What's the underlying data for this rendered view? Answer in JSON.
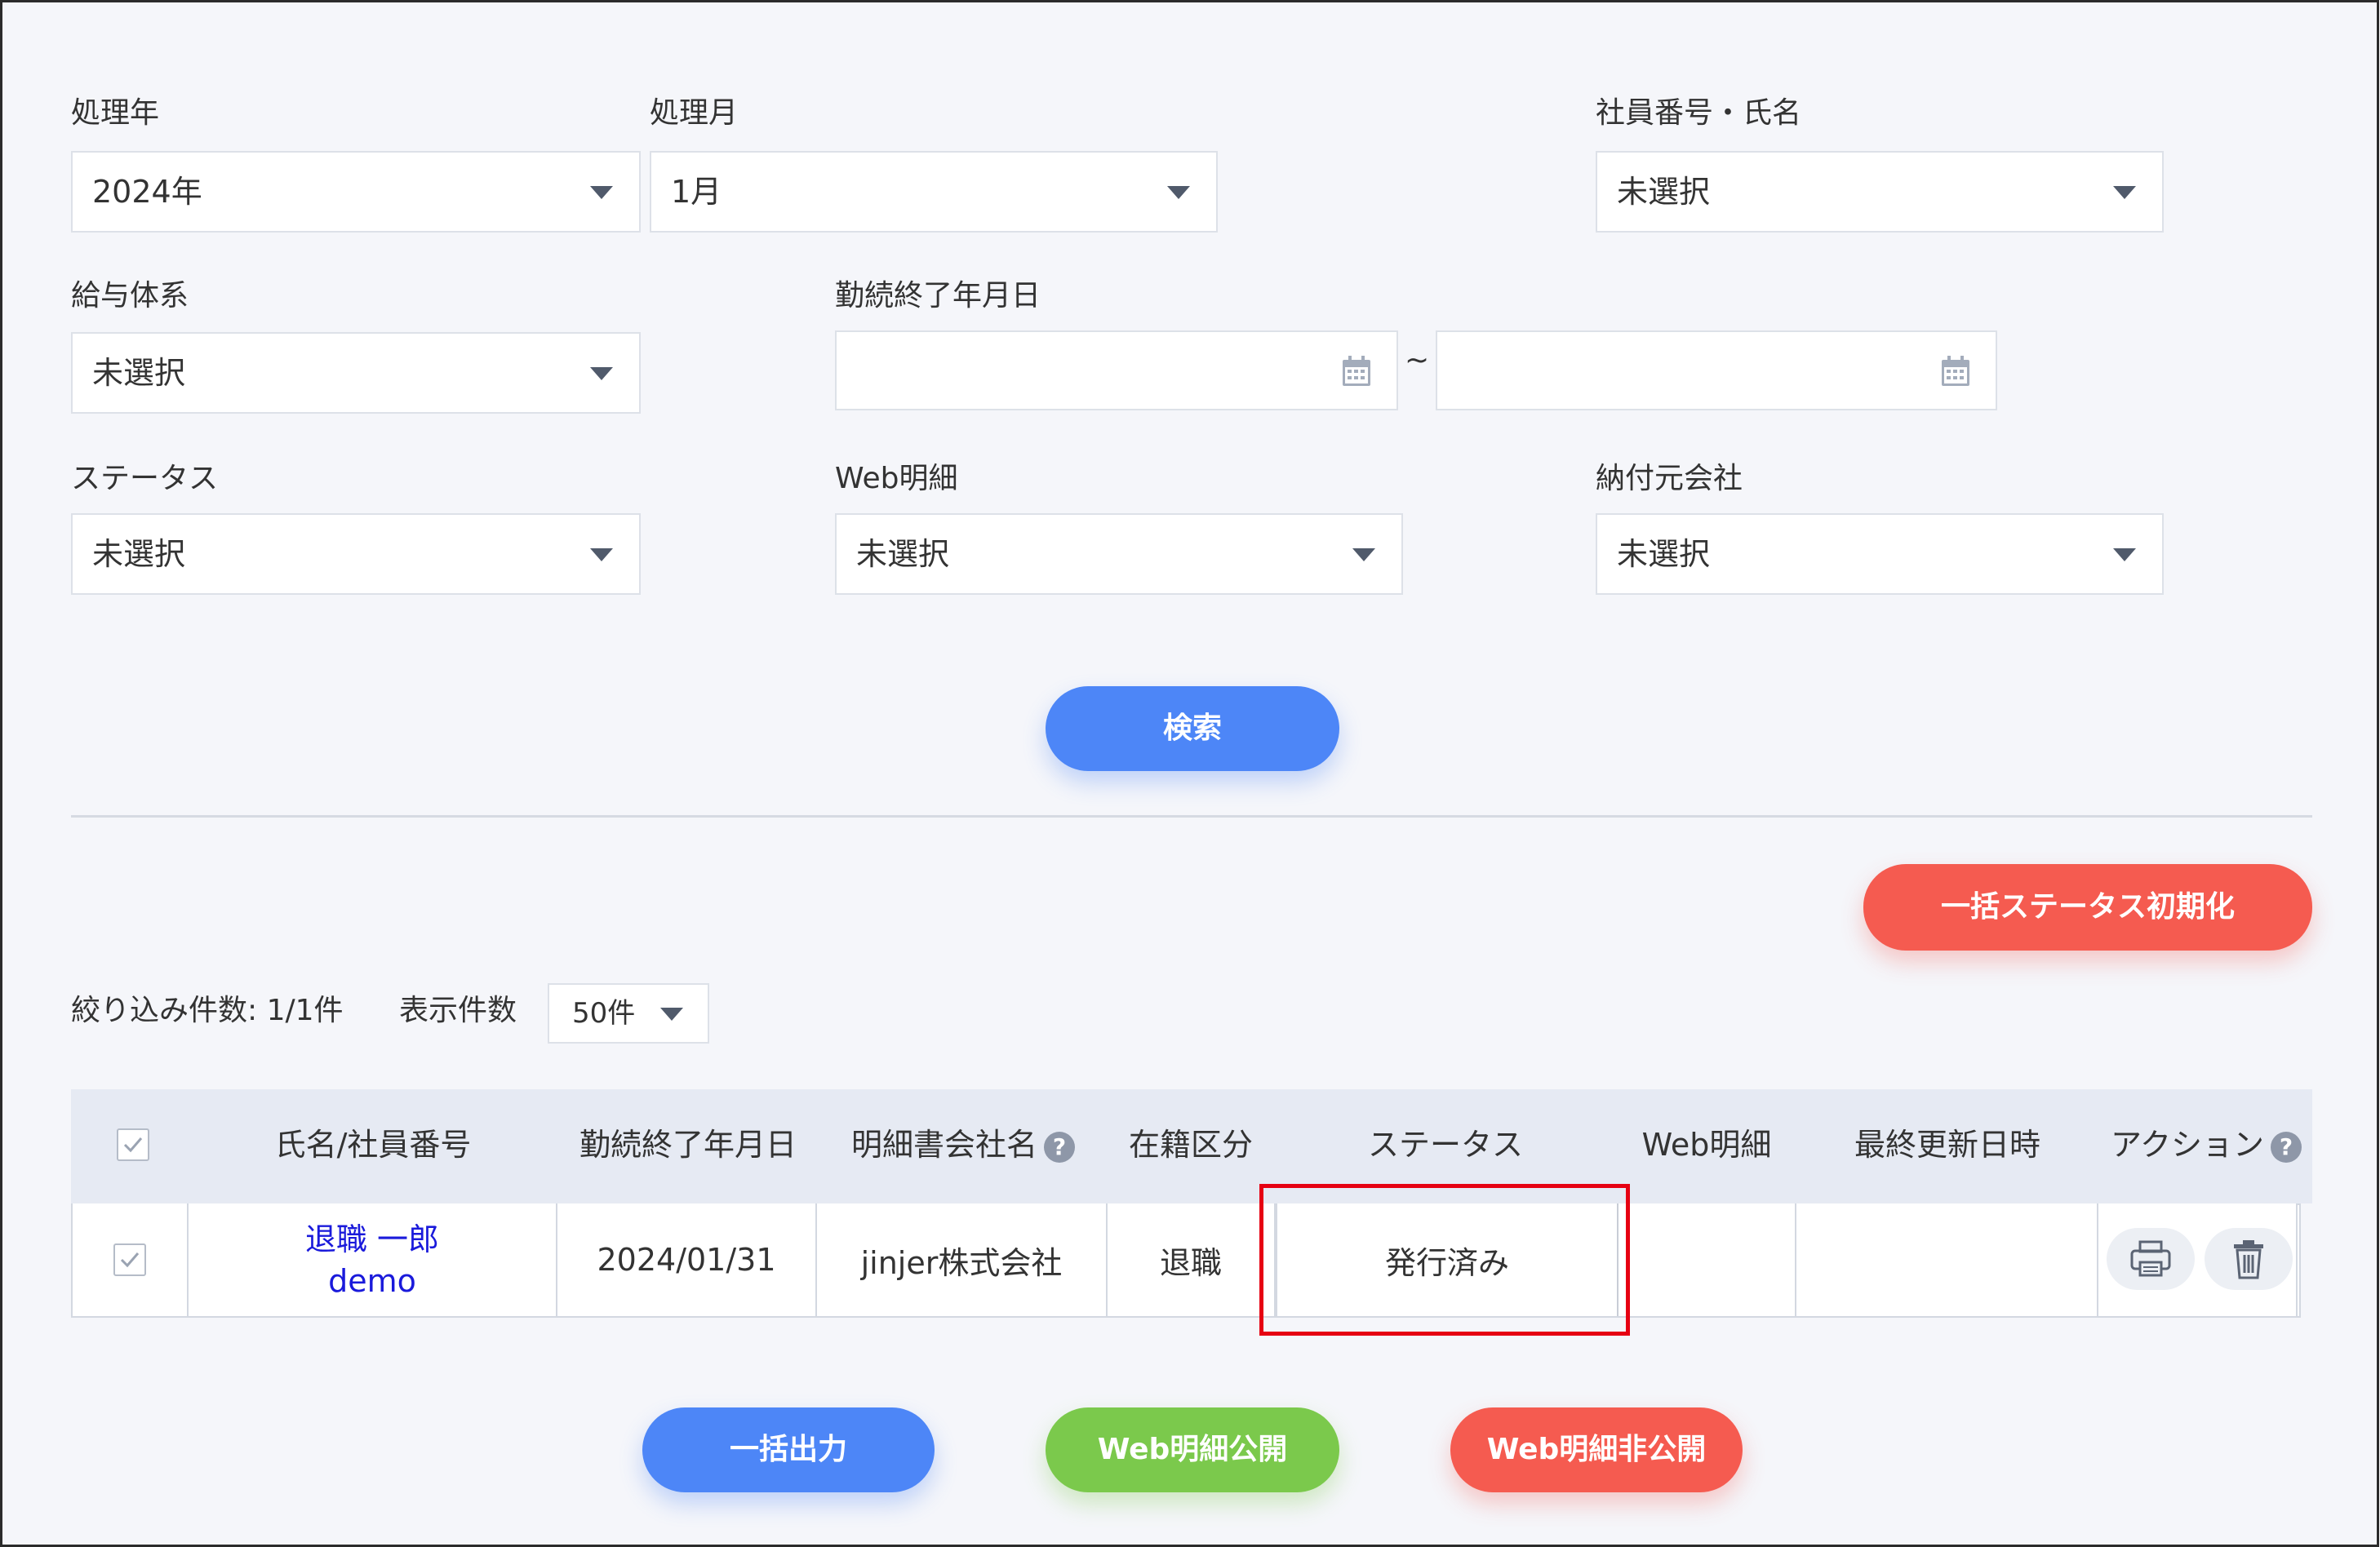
{
  "filters": {
    "year": {
      "label": "処理年",
      "value": "2024年"
    },
    "month": {
      "label": "処理月",
      "value": "1月"
    },
    "employee": {
      "label": "社員番号・氏名",
      "value": "未選択"
    },
    "salary_system": {
      "label": "給与体系",
      "value": "未選択"
    },
    "end_date": {
      "label": "勤続終了年月日",
      "from": "",
      "to": "",
      "separator": "~"
    },
    "status": {
      "label": "ステータス",
      "value": "未選択"
    },
    "web_statement": {
      "label": "Web明細",
      "value": "未選択"
    },
    "payment_company": {
      "label": "納付元会社",
      "value": "未選択"
    }
  },
  "search_label": "検索",
  "bulk_reset_label": "一括ステータス初期化",
  "count": {
    "filtered_label": "絞り込み件数: 1/1件",
    "per_page_label": "表示件数",
    "per_page_value": "50件"
  },
  "table": {
    "headers": {
      "name": "氏名/社員番号",
      "end_date": "勤続終了年月日",
      "company": "明細書会社名",
      "enrollment": "在籍区分",
      "status": "ステータス",
      "web": "Web明細",
      "updated": "最終更新日時",
      "action": "アクション"
    },
    "rows": [
      {
        "name": "退職 一郎",
        "employee_no": "demo",
        "end_date": "2024/01/31",
        "company": "jinjer株式会社",
        "enrollment": "退職",
        "status": "発行済み",
        "web": "",
        "updated": ""
      }
    ]
  },
  "bottom_buttons": {
    "export": "一括出力",
    "publish": "Web明細公開",
    "unpublish": "Web明細非公開"
  },
  "colors": {
    "primary": "#4d86f7",
    "danger": "#f55b50",
    "success": "#7bc94c",
    "highlight": "#e60012",
    "link": "#1a1adb"
  }
}
